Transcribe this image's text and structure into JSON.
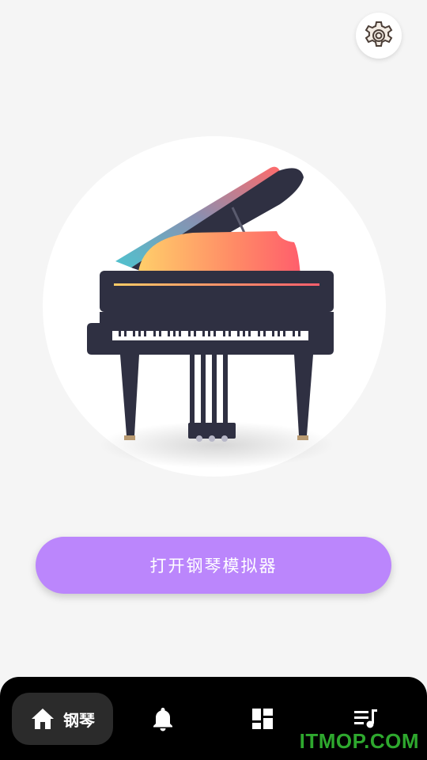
{
  "header": {
    "settings_icon": "gear-icon"
  },
  "hero": {
    "image": "grand-piano-illustration"
  },
  "main": {
    "open_button_label": "打开钢琴模拟器"
  },
  "nav": {
    "items": [
      {
        "icon": "home-icon",
        "label": "钢琴",
        "active": true
      },
      {
        "icon": "bell-icon",
        "label": ""
      },
      {
        "icon": "dashboard-icon",
        "label": ""
      },
      {
        "icon": "playlist-icon",
        "label": ""
      }
    ]
  },
  "watermark": {
    "text": "ITMOP.COM"
  },
  "colors": {
    "background": "#f5f5f5",
    "accent": "#bb86fc",
    "nav_background": "#000000",
    "piano_body": "#2f3042",
    "watermark": "#2ea82e"
  }
}
